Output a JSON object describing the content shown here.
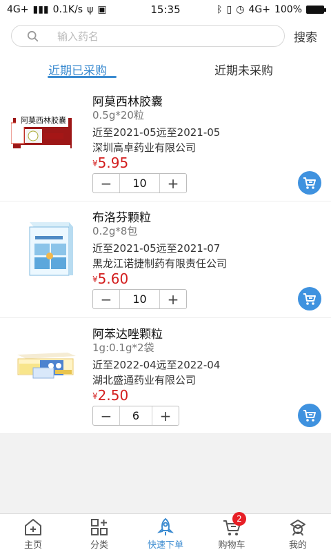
{
  "status_bar": {
    "network": "4G+",
    "speed": "0.1K/s",
    "time": "15:35",
    "network_right": "4G+",
    "battery": "100%"
  },
  "search": {
    "placeholder": "输入药名",
    "button_label": "搜索"
  },
  "tabs": [
    {
      "label": "近期已采购",
      "active": true
    },
    {
      "label": "近期未采购",
      "active": false
    }
  ],
  "products": [
    {
      "name": "阿莫西林胶囊",
      "spec": "0.5g*20粒",
      "expiry": "近至2021-05远至2021-05",
      "company": "深圳高卓药业有限公司",
      "currency": "¥",
      "price": "5.95",
      "quantity": "10",
      "image_icon": "amoxicillin-box-image"
    },
    {
      "name": "布洛芬颗粒",
      "spec": "0.2g*8包",
      "expiry": "近至2021-05远至2021-07",
      "company": "黑龙江诺捷制药有限责任公司",
      "currency": "¥",
      "price": "5.60",
      "quantity": "10",
      "image_icon": "ibuprofen-box-image"
    },
    {
      "name": "阿苯达唑颗粒",
      "spec": "1g:0.1g*2袋",
      "expiry": "近至2022-04远至2022-04",
      "company": "湖北盛通药业有限公司",
      "currency": "¥",
      "price": "2.50",
      "quantity": "6",
      "image_icon": "albendazole-pack-image"
    }
  ],
  "quantity_controls": {
    "minus": "−",
    "plus": "+"
  },
  "bottom_nav": [
    {
      "label": "主页",
      "icon": "home-add-icon",
      "active": false
    },
    {
      "label": "分类",
      "icon": "category-icon",
      "active": false
    },
    {
      "label": "快速下单",
      "icon": "rocket-icon",
      "active": true
    },
    {
      "label": "购物车",
      "icon": "cart-icon",
      "active": false,
      "badge": "2"
    },
    {
      "label": "我的",
      "icon": "profile-icon",
      "active": false
    }
  ],
  "colors": {
    "accent": "#3b8bd0",
    "price": "#d31e1e",
    "badge": "#e71f26"
  }
}
